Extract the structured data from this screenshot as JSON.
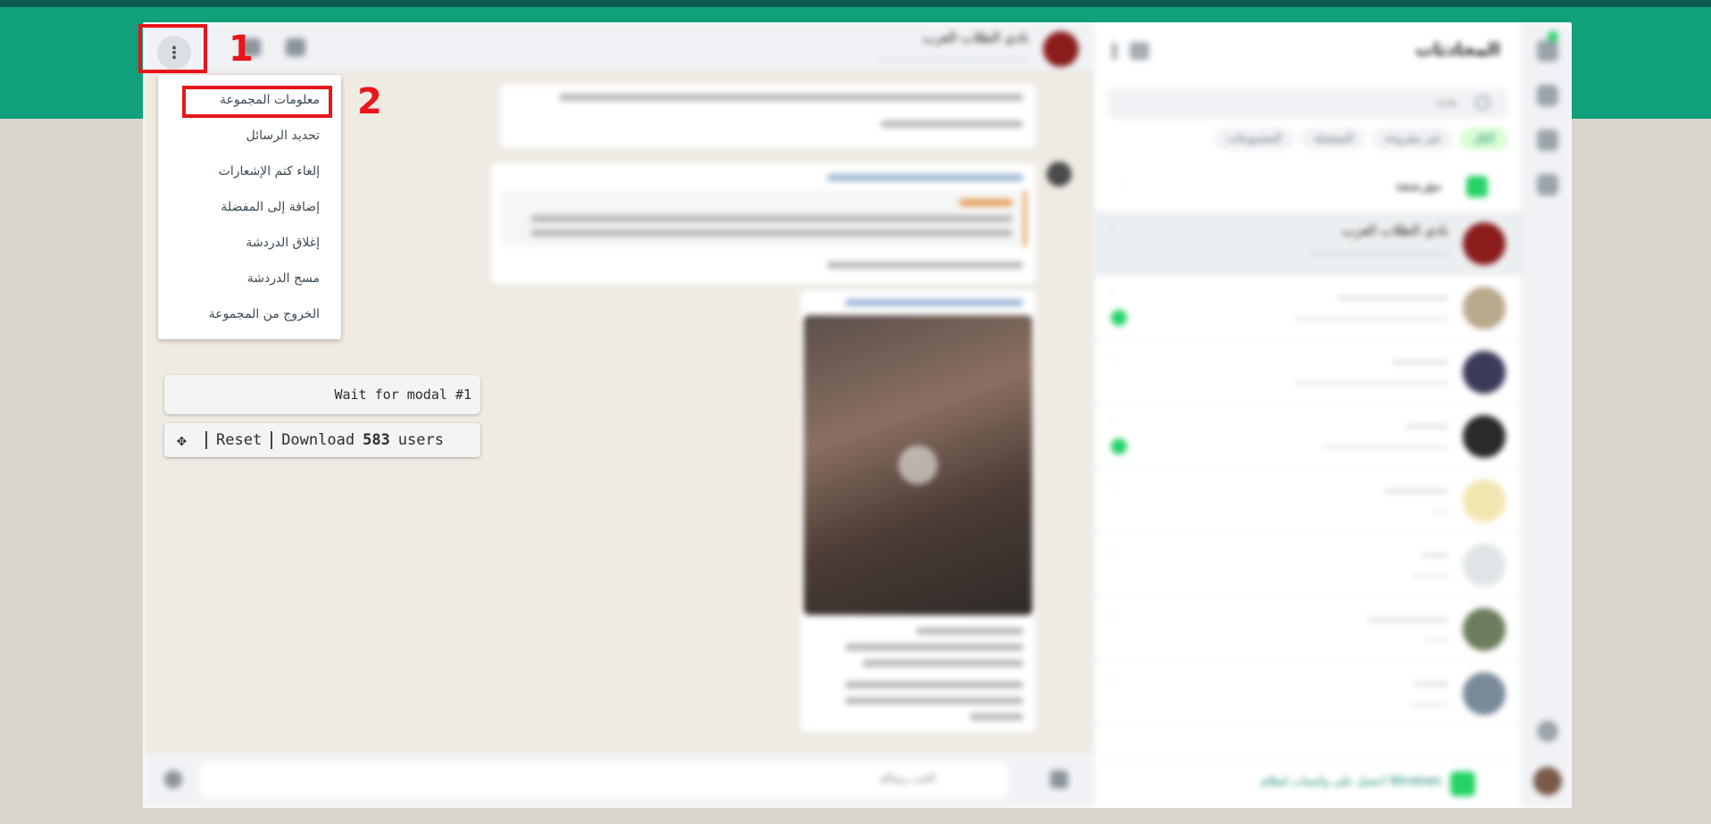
{
  "colors": {
    "brand_green": "#10a07c",
    "highlight_red": "#e8151b",
    "chat_bg": "#efeae2"
  },
  "background_ui": {
    "list_title": "المحادثات",
    "search_placeholder": "بحث",
    "filter_chips": [
      "الكل",
      "غير مقروءة",
      "المفضلة",
      "المجموعات"
    ],
    "archived_label": "مؤرشفة",
    "footer_text": "احصل على واتساب لنظام Windows",
    "conversation_title": "نادي الطلاب العرب",
    "composer_placeholder": "اكتب رسالة"
  },
  "annotations": {
    "step1": "1",
    "step2": "2"
  },
  "kebab_button": {
    "icon": "⋮"
  },
  "menu": {
    "items": [
      "معلومات المجموعة",
      "تحديد الرسائل",
      "إلغاء كتم الإشعارات",
      "إضافة إلى المفضلة",
      "إغلاق الدردشة",
      "مسح الدردشة",
      "الخروج من المجموعة"
    ]
  },
  "extension": {
    "status_text": "Wait for modal #1",
    "move_icon": "✥",
    "reset_label": "Reset",
    "download_label": "Download",
    "user_count": "583",
    "users_label": "users"
  }
}
